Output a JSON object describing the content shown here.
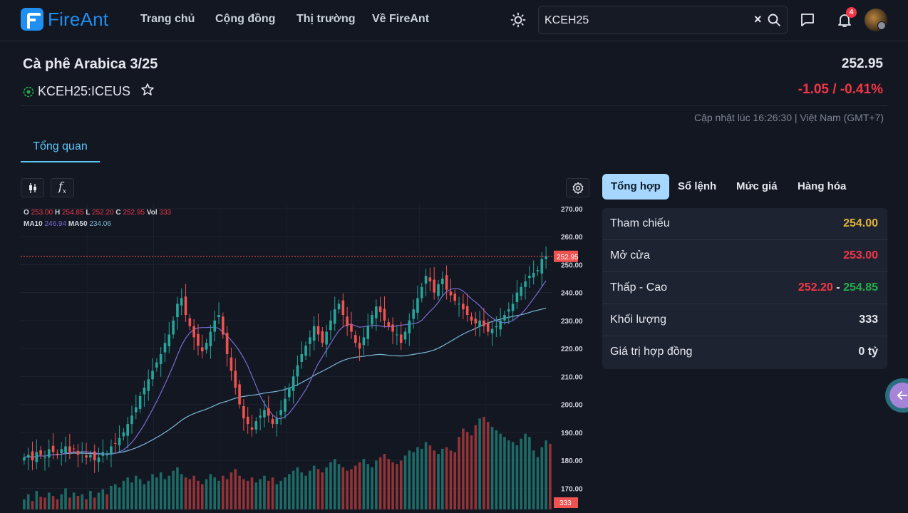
{
  "nav": {
    "brand": "FireAnt",
    "items": [
      "Trang chủ",
      "Cộng đồng",
      "Thị trường",
      "Về FireAnt"
    ],
    "search_value": "KCEH25",
    "notification_count": "4"
  },
  "instrument": {
    "name": "Cà phê Arabica 3/25",
    "symbol": "KCEH25:ICEUS",
    "price": "252.95",
    "change": "-1.05 / -0.41%",
    "updated": "Cập nhật lúc 16:26:30 | Việt Nam (GMT+7)"
  },
  "tabs": {
    "overview": "Tổng quan"
  },
  "legend": {
    "o_label": "O",
    "o": "253.00",
    "h_label": "H",
    "h": "254.85",
    "l_label": "L",
    "l": "252.20",
    "c_label": "C",
    "c": "252.95",
    "vol_label": "Vol",
    "vol": "333",
    "ma10_label": "MA10",
    "ma10": "246.94",
    "ma50_label": "MA50",
    "ma50": "234.06"
  },
  "right_tabs": [
    "Tổng hợp",
    "Sổ lệnh",
    "Mức giá",
    "Hàng hóa"
  ],
  "summary": {
    "ref_label": "Tham chiếu",
    "ref": "254.00",
    "open_label": "Mở cửa",
    "open": "253.00",
    "range_label": "Thấp - Cao",
    "low": "252.20",
    "range_sep": "-",
    "high": "254.85",
    "volume_label": "Khối lượng",
    "volume": "333",
    "value_label": "Giá trị hợp đồng",
    "value": "0 tỷ"
  },
  "colors": {
    "up": "#26a69a",
    "down": "#ef5350",
    "accent": "#5ac8fa",
    "ma10": "#7a6bd1",
    "ma50": "#7bb8d8"
  },
  "chart_data": {
    "type": "candlestick",
    "y_ticks": [
      "270.00",
      "260.00",
      "250.00",
      "240.00",
      "230.00",
      "220.00",
      "210.00",
      "200.00",
      "190.00",
      "180.00",
      "170.00"
    ],
    "ylim": [
      165,
      272
    ],
    "last_price_label": "252.95",
    "last_volume_label": "333",
    "closes": [
      181,
      182,
      180,
      183,
      182,
      181,
      184,
      183,
      182,
      184,
      185,
      183,
      184,
      182,
      183,
      181,
      182,
      180,
      181,
      183,
      182,
      185,
      186,
      188,
      190,
      193,
      196,
      199,
      203,
      206,
      209,
      212,
      215,
      218,
      222,
      225,
      230,
      236,
      238,
      232,
      228,
      224,
      221,
      219,
      222,
      226,
      230,
      232,
      225,
      218,
      212,
      206,
      200,
      195,
      193,
      191,
      194,
      196,
      198,
      196,
      193,
      195,
      198,
      202,
      206,
      210,
      214,
      218,
      221,
      224,
      228,
      225,
      222,
      226,
      230,
      234,
      236,
      232,
      228,
      226,
      222,
      220,
      224,
      228,
      232,
      235,
      233,
      230,
      228,
      226,
      225,
      222,
      226,
      230,
      234,
      238,
      242,
      246,
      244,
      240,
      243,
      245,
      241,
      239,
      237,
      236,
      234,
      232,
      230,
      229,
      230,
      228,
      226,
      227,
      228,
      230,
      232,
      234,
      236,
      240,
      242,
      244,
      246,
      247,
      248,
      252,
      253
    ],
    "volumes": [
      12,
      18,
      10,
      22,
      15,
      14,
      20,
      16,
      12,
      18,
      25,
      14,
      20,
      16,
      18,
      12,
      22,
      14,
      20,
      24,
      18,
      28,
      30,
      26,
      34,
      38,
      32,
      40,
      36,
      30,
      34,
      42,
      38,
      44,
      36,
      40,
      46,
      50,
      42,
      38,
      36,
      40,
      34,
      30,
      36,
      42,
      38,
      34,
      40,
      36,
      44,
      48,
      40,
      36,
      34,
      38,
      32,
      36,
      40,
      34,
      38,
      30,
      34,
      38,
      42,
      46,
      50,
      44,
      40,
      46,
      52,
      48,
      44,
      50,
      56,
      60,
      54,
      50,
      46,
      48,
      52,
      56,
      60,
      54,
      50,
      58,
      62,
      66,
      60,
      56,
      54,
      58,
      64,
      70,
      68,
      74,
      72,
      80,
      76,
      70,
      66,
      72,
      74,
      70,
      68,
      86,
      96,
      92,
      88,
      100,
      108,
      110,
      104,
      98,
      94,
      90,
      86,
      82,
      80,
      76,
      84,
      90,
      86,
      70,
      62,
      74,
      82,
      78
    ]
  }
}
